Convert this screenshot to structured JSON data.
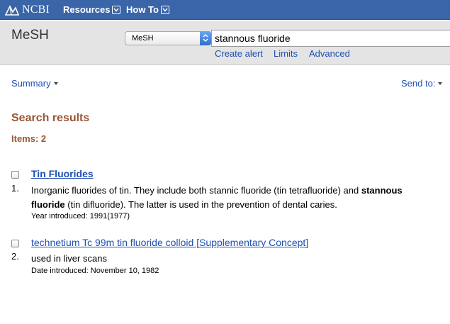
{
  "topbar": {
    "logo_text": "NCBI",
    "nav": [
      {
        "label": "Resources"
      },
      {
        "label": "How To"
      }
    ]
  },
  "search": {
    "title": "MeSH",
    "database": "MeSH",
    "query": "stannous fluoride",
    "links": [
      "Create alert",
      "Limits",
      "Advanced"
    ]
  },
  "controls": {
    "summary_label": "Summary",
    "send_to_label": "Send to:"
  },
  "results": {
    "heading": "Search results",
    "items_count": "Items: 2",
    "items": [
      {
        "number": "1.",
        "title": "Tin Fluorides",
        "desc_line1_before": "Inorganic fluorides of tin. They include both stannic fluoride (tin tetrafluoride) and ",
        "desc_line1_bold": "stannous",
        "desc_line2_bold": "fluoride",
        "desc_line2_after": " (tin difluoride). The latter is used in the prevention of dental caries.",
        "meta": "Year introduced: 1991(1977)"
      },
      {
        "number": "2.",
        "title": "technetium Tc 99m tin fluoride colloid [Supplementary Concept]",
        "desc": "used in liver scans",
        "meta": "Date introduced: November 10, 1982"
      }
    ]
  },
  "colors": {
    "topbar_bg": "#3a65a8",
    "link": "#1f4fb0",
    "heading_brown": "#985735"
  }
}
